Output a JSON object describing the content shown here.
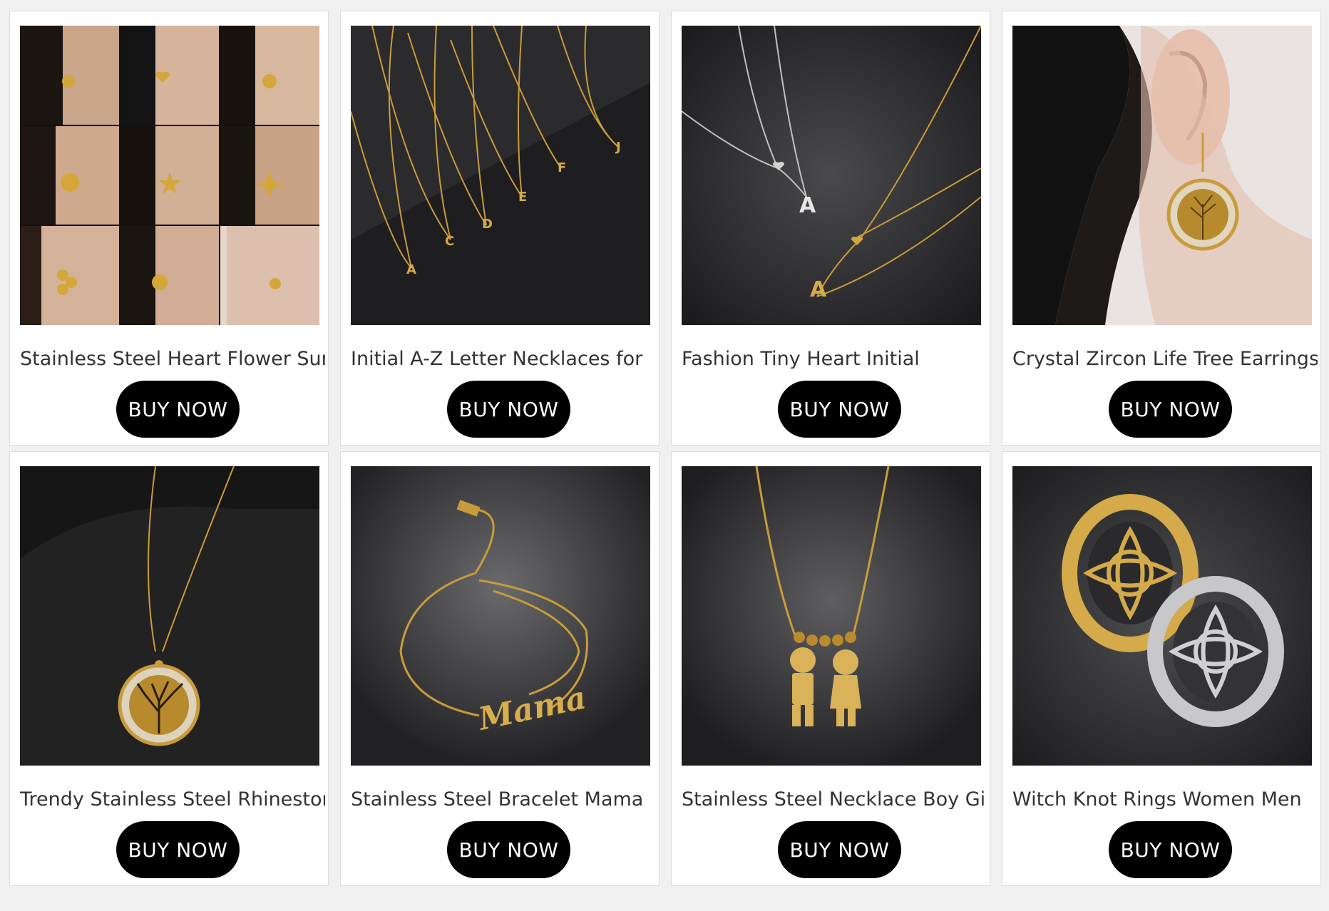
{
  "button_label": "BUY NOW",
  "colors": {
    "button_bg": "#000000",
    "button_text": "#ffffff",
    "page_bg": "#f0f0f0",
    "card_bg": "#ffffff"
  },
  "products": [
    {
      "title": "Stainless Steel Heart Flower Sun",
      "image": "earrings-collage-image",
      "button": "BUY NOW"
    },
    {
      "title": "Initial A-Z Letter Necklaces for",
      "image": "letter-necklaces-image",
      "button": "BUY NOW"
    },
    {
      "title": "Fashion Tiny Heart Initial",
      "image": "heart-initial-necklace-image",
      "button": "BUY NOW"
    },
    {
      "title": "Crystal Zircon Life Tree Earrings",
      "image": "tree-earring-image",
      "button": "BUY NOW"
    },
    {
      "title": "Trendy Stainless Steel Rhinestone",
      "image": "tree-pendant-necklace-image",
      "button": "BUY NOW"
    },
    {
      "title": "Stainless Steel Bracelet Mama",
      "image": "mama-bracelet-image",
      "button": "BUY NOW"
    },
    {
      "title": "Stainless Steel Necklace Boy Girl",
      "image": "boy-girl-necklace-image",
      "button": "BUY NOW"
    },
    {
      "title": "Witch Knot Rings Women Men",
      "image": "witch-knot-rings-image",
      "button": "BUY NOW"
    }
  ]
}
